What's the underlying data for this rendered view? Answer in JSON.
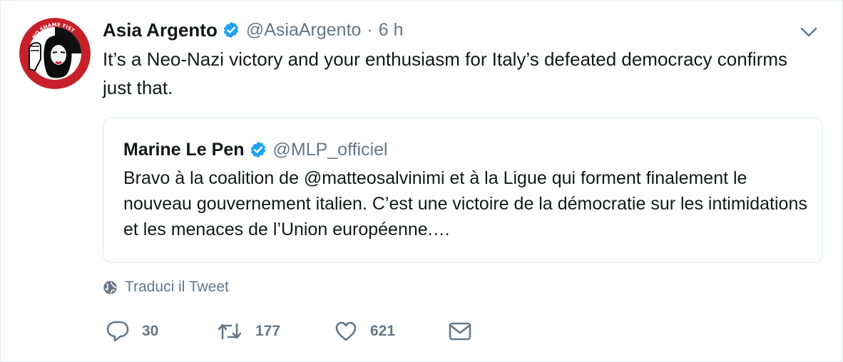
{
  "tweet": {
    "author_name": "Asia Argento",
    "author_handle": "@AsiaArgento",
    "separator": "·",
    "timestamp": "6 h",
    "text": "It’s a Neo-Nazi victory and your enthusiasm for Italy’s defeated democracy confirms just that.",
    "verified": true,
    "avatar_icon": "no-shame-fist-avatar",
    "avatar_text": "NO SHAME FIST",
    "menu_icon": "chevron-down-icon"
  },
  "quoted_tweet": {
    "author_name": "Marine Le Pen",
    "author_handle": "@MLP_officiel",
    "verified": true,
    "text": "Bravo à la coalition de @matteosalvinimi et à la Ligue qui forment finalement le nouveau gouvernement italien. C’est une victoire de la démocratie sur les intimidations et les menaces de l’Union européenne.…"
  },
  "translate": {
    "label": "Traduci il Tweet",
    "icon": "globe-icon"
  },
  "actions": {
    "reply_count": "30",
    "retweet_count": "177",
    "like_count": "621",
    "reply_icon": "reply-icon",
    "retweet_icon": "retweet-icon",
    "like_icon": "heart-icon",
    "dm_icon": "envelope-icon"
  },
  "colors": {
    "verified_blue": "#1da1f2",
    "secondary_text": "#657786",
    "primary_text": "#14171a",
    "border": "#e1e8ed",
    "avatar_red": "#c8202a"
  }
}
